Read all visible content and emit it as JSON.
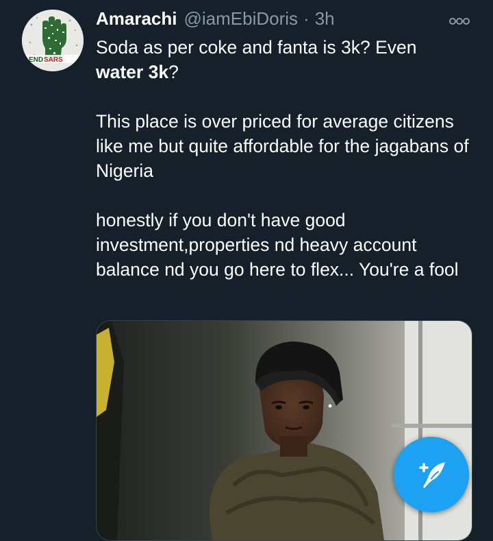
{
  "tweet": {
    "author_name": "Amarachi",
    "author_handle": "@iamEbiDoris",
    "separator": "·",
    "timestamp": "3h",
    "avatar_badge_text": "ENDSARS",
    "body": {
      "line1_pre": "Soda as per coke and fanta is 3k? Even",
      "line2_bold": "water 3k",
      "line2_post": "?",
      "paragraph2": "This place is over priced for average citizens like me but quite affordable for the jagabans of Nigeria",
      "paragraph3": "honestly if you don't have good investment,properties nd heavy account balance nd you go here to flex... You're a fool"
    }
  },
  "icons": {
    "more": "more-options-icon",
    "compose": "compose-tweet-icon",
    "avatar": "raised-fist-avatar"
  },
  "colors": {
    "background": "#15202b",
    "secondary_text": "#8899a6",
    "accent": "#1da1f2",
    "text": "#ffffff"
  }
}
